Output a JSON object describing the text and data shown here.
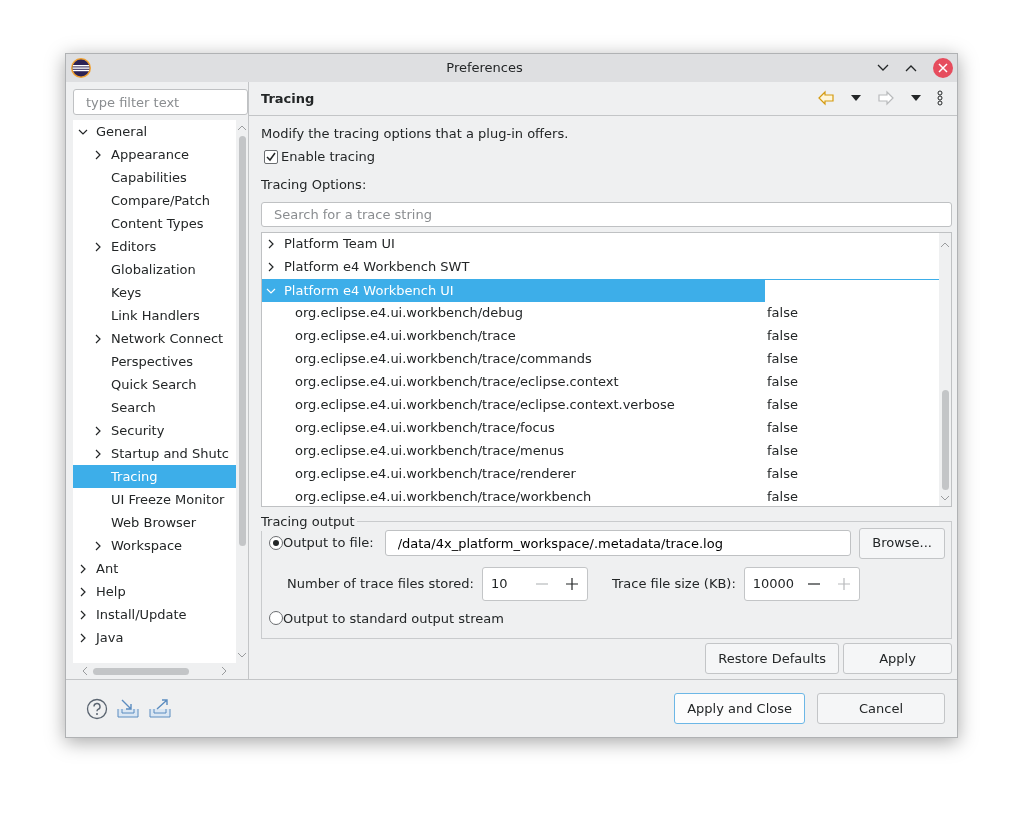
{
  "window": {
    "title": "Preferences"
  },
  "filter": {
    "placeholder": "type filter text"
  },
  "tree": [
    {
      "label": "General",
      "kind": "folder",
      "expanded": true,
      "selected": false,
      "children": [
        {
          "label": "Appearance",
          "kind": "folder",
          "expanded": false,
          "selected": false
        },
        {
          "label": "Capabilities",
          "kind": "page",
          "selected": false
        },
        {
          "label": "Compare/Patch",
          "kind": "page",
          "selected": false
        },
        {
          "label": "Content Types",
          "kind": "page",
          "selected": false
        },
        {
          "label": "Editors",
          "kind": "folder",
          "expanded": false,
          "selected": false
        },
        {
          "label": "Globalization",
          "kind": "page",
          "selected": false
        },
        {
          "label": "Keys",
          "kind": "page",
          "selected": false
        },
        {
          "label": "Link Handlers",
          "kind": "page",
          "selected": false
        },
        {
          "label": "Network Connect",
          "kind": "folder",
          "expanded": false,
          "selected": false
        },
        {
          "label": "Perspectives",
          "kind": "page",
          "selected": false
        },
        {
          "label": "Quick Search",
          "kind": "page",
          "selected": false
        },
        {
          "label": "Search",
          "kind": "page",
          "selected": false
        },
        {
          "label": "Security",
          "kind": "folder",
          "expanded": false,
          "selected": false
        },
        {
          "label": "Startup and Shutc",
          "kind": "folder",
          "expanded": false,
          "selected": false
        },
        {
          "label": "Tracing",
          "kind": "page",
          "selected": true
        },
        {
          "label": "UI Freeze Monitor",
          "kind": "page",
          "selected": false
        },
        {
          "label": "Web Browser",
          "kind": "page",
          "selected": false
        },
        {
          "label": "Workspace",
          "kind": "folder",
          "expanded": false,
          "selected": false
        }
      ]
    },
    {
      "label": "Ant",
      "kind": "folder",
      "expanded": false,
      "selected": false
    },
    {
      "label": "Help",
      "kind": "folder",
      "expanded": false,
      "selected": false
    },
    {
      "label": "Install/Update",
      "kind": "folder",
      "expanded": false,
      "selected": false
    },
    {
      "label": "Java",
      "kind": "folder",
      "expanded": false,
      "selected": false
    }
  ],
  "page": {
    "title": "Tracing",
    "back_disabled": false,
    "forward_disabled": true,
    "description": "Modify the tracing options that a plug-in offers.",
    "enable_tracing": {
      "label": "Enable tracing",
      "checked": true
    },
    "options_label": "Tracing Options:",
    "search": {
      "placeholder": "Search for a trace string"
    },
    "trace_tree": [
      {
        "label": "Platform Team UI",
        "expanded": false,
        "selected": false
      },
      {
        "label": "Platform e4 Workbench SWT",
        "expanded": false,
        "selected": false
      },
      {
        "label": "Platform e4 Workbench UI",
        "expanded": true,
        "selected": true,
        "children": [
          {
            "label": "org.eclipse.e4.ui.workbench/debug",
            "value": "false"
          },
          {
            "label": "org.eclipse.e4.ui.workbench/trace",
            "value": "false"
          },
          {
            "label": "org.eclipse.e4.ui.workbench/trace/commands",
            "value": "false"
          },
          {
            "label": "org.eclipse.e4.ui.workbench/trace/eclipse.context",
            "value": "false"
          },
          {
            "label": "org.eclipse.e4.ui.workbench/trace/eclipse.context.verbose",
            "value": "false"
          },
          {
            "label": "org.eclipse.e4.ui.workbench/trace/focus",
            "value": "false"
          },
          {
            "label": "org.eclipse.e4.ui.workbench/trace/menus",
            "value": "false"
          },
          {
            "label": "org.eclipse.e4.ui.workbench/trace/renderer",
            "value": "false"
          },
          {
            "label": "org.eclipse.e4.ui.workbench/trace/workbench",
            "value": "false"
          }
        ]
      }
    ],
    "output": {
      "title": "Tracing output",
      "options": [
        {
          "label": "Output to file:",
          "selected": true
        },
        {
          "label": "Output to standard output stream",
          "selected": false
        }
      ],
      "file_path": "/data/4x_platform_workspace/.metadata/trace.log",
      "browse": "Browse...",
      "spinners": [
        {
          "label": "Number of trace files stored:",
          "value": "10",
          "decrement_disabled": true,
          "increment_disabled": false
        },
        {
          "label": "Trace file size (KB):",
          "value": "10000",
          "decrement_disabled": false,
          "increment_disabled": true
        }
      ]
    },
    "buttons": [
      "Restore Defaults",
      "Apply"
    ]
  },
  "dialog_buttons": [
    {
      "label": "Apply and Close",
      "default": true
    },
    {
      "label": "Cancel",
      "default": false
    }
  ]
}
